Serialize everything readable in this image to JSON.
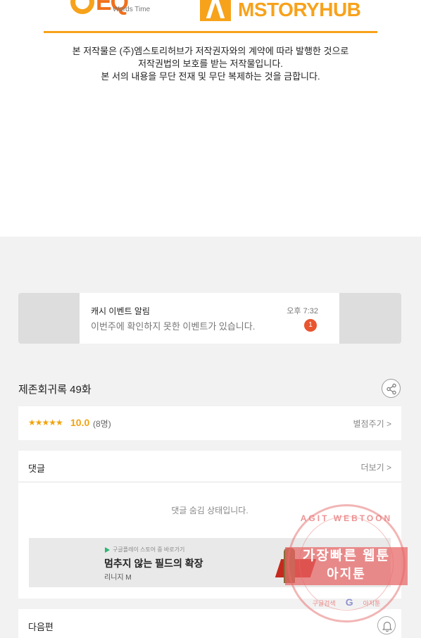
{
  "header": {
    "logo_left": {
      "mark": "EQ",
      "sub": "Words Time"
    },
    "logo_right": {
      "text": "MSTORYHUB"
    },
    "copyright_lines": [
      "본 저작물은 (주)엠스토리허브가 저작권자와의 계약에 따라 발행한 것으로",
      "저작권법의 보호를 받는 저작물입니다.",
      "본 서의 내용을 무단 전재 및 무단 복제하는 것을 금합니다."
    ]
  },
  "notice": {
    "title": "캐시 이벤트 알림",
    "message": "이번주에 확인하지 못한 이벤트가 있습니다.",
    "time": "오후 7:32",
    "badge": "1"
  },
  "episode": {
    "title": "제존회귀록 49화"
  },
  "rating": {
    "stars": "★★★★★",
    "score": "10.0",
    "count": "(8명)",
    "rate_link": "별점주기 >"
  },
  "comments": {
    "label": "댓글",
    "more": "더보기 >",
    "hidden_msg": "댓글 숨김 상태입니다."
  },
  "ad": {
    "store": "구글플레이 스토어 중 바로가기",
    "title": "멈추지 않는 필드의 확장",
    "subtitle": "리니지 M"
  },
  "next": {
    "label": "다음편"
  },
  "watermark": {
    "ring_text": "AGIT WEBTOON",
    "line1": "가장빠른 웹툰",
    "line2": "아지툰",
    "bottom_left": "구글검색",
    "bottom_g": "G",
    "bottom_right": "아지툰"
  },
  "colors": {
    "accent": "#f7a21b",
    "badge": "#e8552f",
    "star": "#f2a30f"
  },
  "icons": [
    "play-store-icon",
    "share-icon",
    "bell-icon",
    "chevron-right-icon"
  ]
}
